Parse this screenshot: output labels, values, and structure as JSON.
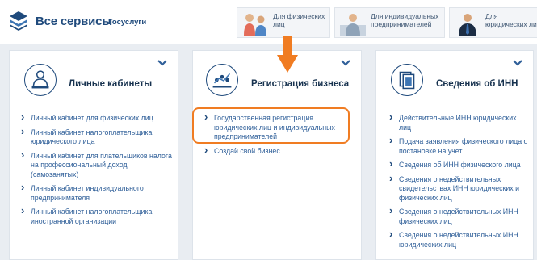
{
  "header": {
    "brand_title": "Все сервисы",
    "brand_sub": "Госуслуги",
    "audiences": [
      {
        "label": "Для физических лиц"
      },
      {
        "label": "Для индивидуальных предпринимателей"
      },
      {
        "label": "Для юридических лиц"
      }
    ]
  },
  "cards": [
    {
      "title": "Личные кабинеты",
      "icon": "person-desk-icon",
      "links": [
        "Личный кабинет для физических лиц",
        "Личный кабинет налогоплательщика юридического лица",
        "Личный кабинет для плательщиков налога на профессиональный доход (самозанятых)",
        "Личный кабинет индивидуального предпринимателя",
        "Личный кабинет налогоплательщика иностранной организации"
      ]
    },
    {
      "title": "Регистрация бизнеса",
      "icon": "growth-chart-icon",
      "links": [
        "Государственная регистрация юридических лиц и индивидуальных предпринимателей",
        "Создай свой бизнес"
      ]
    },
    {
      "title": "Сведения об ИНН",
      "icon": "documents-icon",
      "links": [
        "Действительные ИНН юридических лиц",
        "Подача заявления физического лица о постановке на учет",
        "Сведения об ИНН физического лица",
        "Сведения о недействительных свидетельствах ИНН юридических и физических лиц",
        "Сведения о недействительных ИНН физических лиц",
        "Сведения о недействительных ИНН юридических лиц"
      ]
    }
  ],
  "colors": {
    "accent": "#1f4a7c",
    "link": "#2f5f99",
    "highlight": "#f07c22"
  }
}
